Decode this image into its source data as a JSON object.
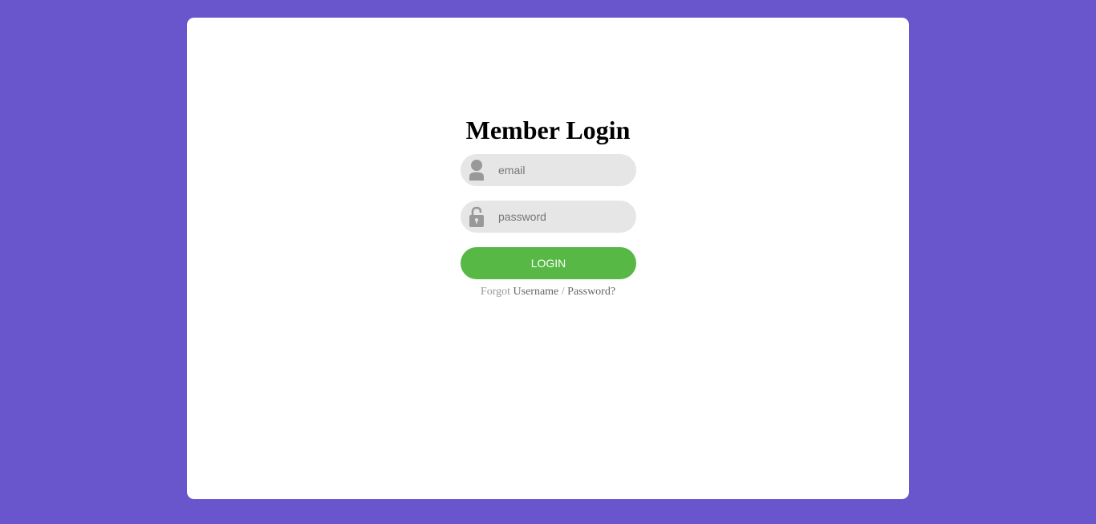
{
  "login": {
    "title": "Member Login",
    "email": {
      "placeholder": "email",
      "value": "",
      "icon": "user-icon"
    },
    "password": {
      "placeholder": "password",
      "value": "",
      "icon": "lock-icon"
    },
    "button_label": "LOGIN",
    "forgot": {
      "prefix": "Forgot",
      "username_link": "Username",
      "separator": "/",
      "password_link": "Password?"
    }
  },
  "colors": {
    "background": "#6a56cc",
    "card": "#ffffff",
    "field": "#e6e6e6",
    "icon": "#999999",
    "button": "#57b846",
    "button_text": "#ffffff"
  }
}
